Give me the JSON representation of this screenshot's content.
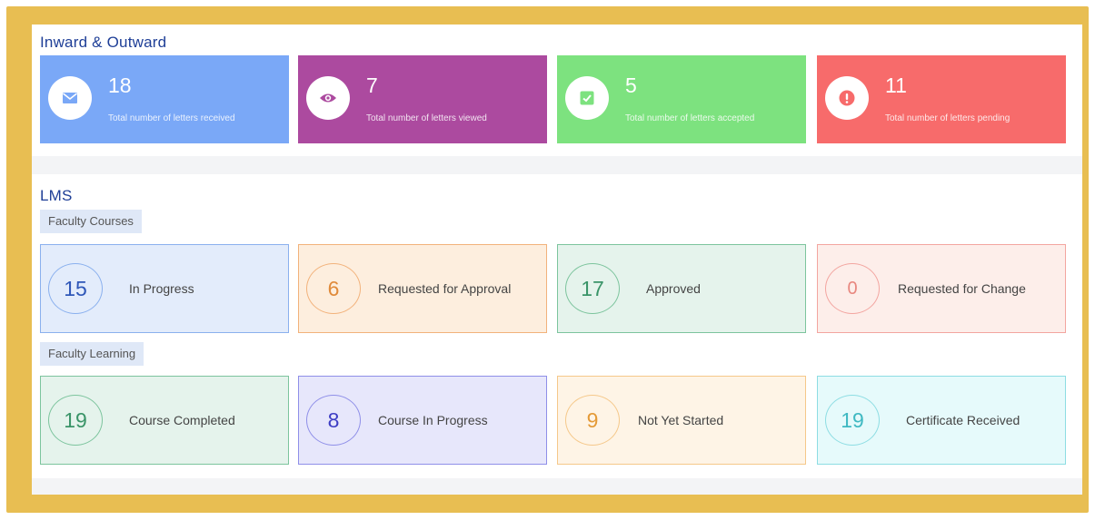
{
  "inout": {
    "title": "Inward & Outward",
    "stats": [
      {
        "value": "18",
        "label": "Total number of letters received",
        "color": "#7aa8f7",
        "icon": "envelope-icon"
      },
      {
        "value": "7",
        "label": "Total number of letters viewed",
        "color": "#ac4a9f",
        "icon": "eye-icon"
      },
      {
        "value": "5",
        "label": "Total number of letters accepted",
        "color": "#7de27f",
        "icon": "check-square-icon"
      },
      {
        "value": "11",
        "label": "Total number of letters pending",
        "color": "#f76b6b",
        "icon": "exclamation-icon"
      }
    ]
  },
  "lms": {
    "title": "LMS",
    "courses": {
      "title": "Faculty Courses",
      "cards": [
        {
          "value": "15",
          "label": "In Progress",
          "bg": "#e3ecfb",
          "border": "#8ab0ee",
          "color": "#2f57b8"
        },
        {
          "value": "6",
          "label": "Requested for Approval",
          "bg": "#fdeede",
          "border": "#f2b27b",
          "color": "#e08a3a"
        },
        {
          "value": "17",
          "label": "Approved",
          "bg": "#e5f3ec",
          "border": "#7cc49d",
          "color": "#3a9468"
        },
        {
          "value": "0",
          "label": "Requested for Change",
          "bg": "#fdeeea",
          "border": "#f3a5a0",
          "color": "#e8877f"
        }
      ]
    },
    "learning": {
      "title": "Faculty Learning",
      "cards": [
        {
          "value": "19",
          "label": "Course Completed",
          "bg": "#e5f3ec",
          "border": "#7cc49d",
          "color": "#3a9468"
        },
        {
          "value": "8",
          "label": "Course In Progress",
          "bg": "#e7e7fb",
          "border": "#8f8fe8",
          "color": "#3d3dc4"
        },
        {
          "value": "9",
          "label": "Not Yet Started",
          "bg": "#fef4e6",
          "border": "#f5c88a",
          "color": "#e49a37"
        },
        {
          "value": "19",
          "label": "Certificate Received",
          "bg": "#e6fafb",
          "border": "#8ddde3",
          "color": "#3fb9c2"
        }
      ]
    }
  }
}
